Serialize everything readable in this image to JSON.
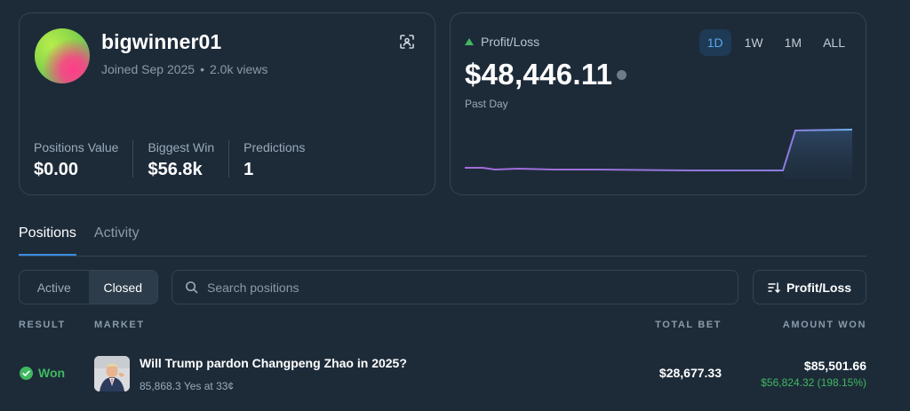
{
  "profile": {
    "username": "bigwinner01",
    "joined": "Joined Sep 2025",
    "views": "2.0k views",
    "stats": [
      {
        "label": "Positions Value",
        "value": "$0.00"
      },
      {
        "label": "Biggest Win",
        "value": "$56.8k"
      },
      {
        "label": "Predictions",
        "value": "1"
      }
    ]
  },
  "pnl": {
    "label": "Profit/Loss",
    "value": "$48,446.11",
    "period_label": "Past Day",
    "ranges": [
      "1D",
      "1W",
      "1M",
      "ALL"
    ],
    "active_range": "1D",
    "colors": {
      "up": "#3fb85f",
      "line_start": "#a46bd8",
      "line_end": "#6fb2ef"
    }
  },
  "tabs": [
    "Positions",
    "Activity"
  ],
  "filter": {
    "active": "Active",
    "closed": "Closed"
  },
  "search": {
    "placeholder": "Search positions"
  },
  "sort": {
    "label": "Profit/Loss"
  },
  "table": {
    "headers": {
      "result": "RESULT",
      "market": "MARKET",
      "total_bet": "TOTAL BET",
      "amount_won": "AMOUNT WON"
    },
    "rows": [
      {
        "result": "Won",
        "title": "Will Trump pardon Changpeng Zhao in 2025?",
        "subtitle": "85,868.3 Yes at 33¢",
        "total_bet": "$28,677.33",
        "amount_won": "$85,501.66",
        "profit": "$56,824.32 (198.15%)"
      }
    ]
  }
}
